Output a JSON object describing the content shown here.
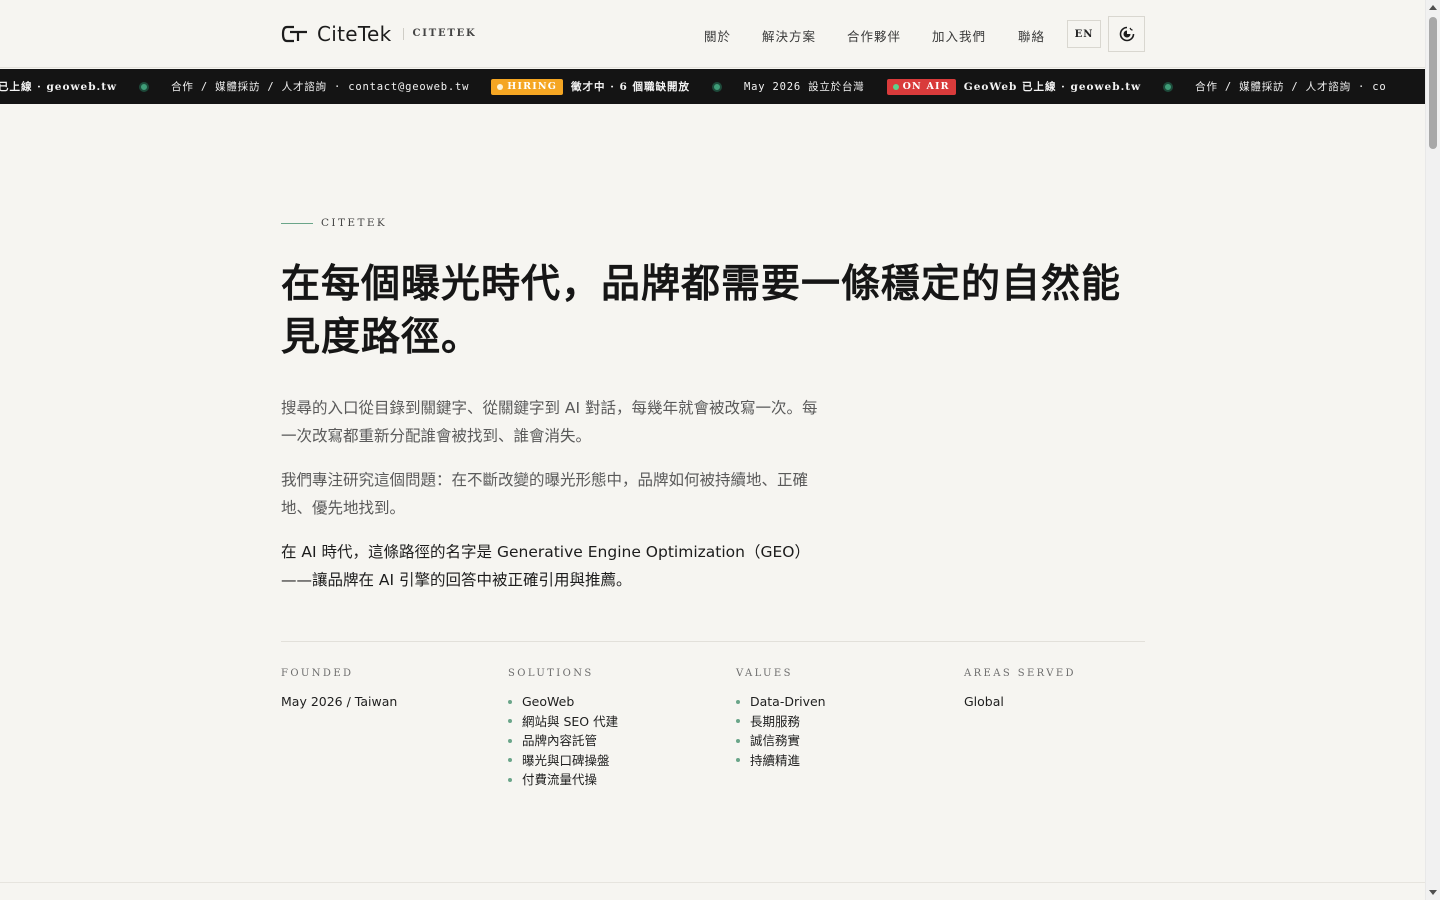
{
  "brand": {
    "name": "CiteTek",
    "sub": "CITETEK"
  },
  "nav": {
    "items": [
      "關於",
      "解決方案",
      "合作夥伴",
      "加入我們",
      "聯絡"
    ],
    "lang_label": "EN",
    "theme_icon": "theme-toggle-icon"
  },
  "ticker": {
    "seg_launch_tail": "已上線 · geoweb.tw",
    "seg_contact": "合作 / 媒體採訪 / 人才諮詢 · contact@geoweb.tw",
    "hiring_badge": "HIRING",
    "seg_hiring": "徵才中 · 6 個職缺開放",
    "seg_founded": "May 2026 設立於台灣",
    "onair_badge": "ON AIR",
    "seg_launch": "GeoWeb 已上線 · geoweb.tw",
    "seg_contact_2": "合作 / 媒體採訪 / 人才諮詢 · co"
  },
  "hero": {
    "eyebrow": "CITETEK",
    "headline": "在每個曝光時代，品牌都需要一條穩定的自然能見度路徑。",
    "p1": "搜尋的入口從目錄到關鍵字、從關鍵字到 AI 對話，每幾年就會被改寫一次。每一次改寫都重新分配誰會被找到、誰會消失。",
    "p2": "我們專注研究這個問題：在不斷改變的曝光形態中，品牌如何被持續地、正確地、優先地找到。",
    "p3": "在 AI 時代，這條路徑的名字是 Generative Engine Optimization（GEO）——讓品牌在 AI 引擎的回答中被正確引用與推薦。"
  },
  "facts": {
    "founded": {
      "label": "FOUNDED",
      "value": "May 2026 / Taiwan"
    },
    "solutions": {
      "label": "SOLUTIONS",
      "items": [
        "GeoWeb",
        "網站與 SEO 代建",
        "品牌內容託管",
        "曝光與口碑操盤",
        "付費流量代操"
      ]
    },
    "values": {
      "label": "VALUES",
      "items": [
        "Data-Driven",
        "長期服務",
        "誠信務實",
        "持續精進"
      ]
    },
    "areas": {
      "label": "AREAS SERVED",
      "value": "Global"
    }
  },
  "colors": {
    "background": "#f6f5f1",
    "ticker_bg": "#141414",
    "accent_green": "#3f9d78",
    "hiring_orange": "#f5a623",
    "onair_red": "#d93b3b"
  }
}
